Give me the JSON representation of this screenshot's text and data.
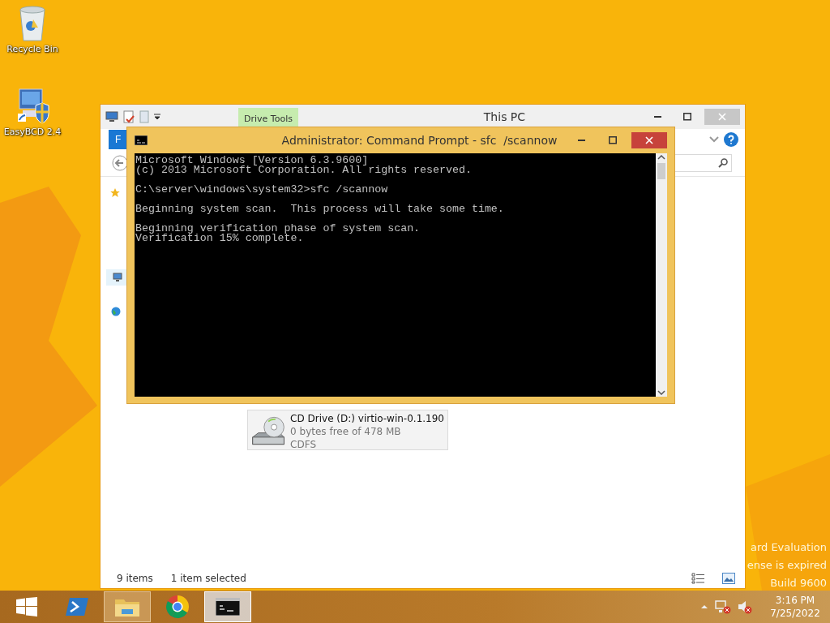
{
  "desktop_icons": [
    {
      "label": "Recycle Bin",
      "kind": "recycle-bin"
    },
    {
      "label": "EasyBCD 2.4",
      "kind": "app"
    }
  ],
  "explorer": {
    "title": "This PC",
    "context_tab": "Drive Tools",
    "ribbon_tab": "F",
    "drive": {
      "name": "CD Drive (D:) virtio-win-0.1.190",
      "free": "0 bytes free of 478 MB",
      "filesystem": "CDFS",
      "selected": true
    },
    "status": {
      "items": "9 items",
      "selection": "1 item selected"
    }
  },
  "console": {
    "title": "Administrator: Command Prompt - sfc  /scannow",
    "blocks": [
      [
        "Microsoft Windows [Version 6.3.9600]",
        "(c) 2013 Microsoft Corporation. All rights reserved."
      ],
      [
        "C:\\server\\windows\\system32>sfc /scannow"
      ],
      [
        "Beginning system scan.  This process will take some time."
      ],
      [
        "Beginning verification phase of system scan.",
        "Verification 15% complete."
      ]
    ]
  },
  "desktop_notice": [
    "ard Evaluation",
    "ense is expired",
    "Build 9600"
  ],
  "taskbar": {
    "apps": [
      {
        "kind": "start",
        "running": false,
        "selected": false
      },
      {
        "kind": "powershell",
        "running": false,
        "selected": false
      },
      {
        "kind": "explorer",
        "running": true,
        "selected": false
      },
      {
        "kind": "chrome",
        "running": false,
        "selected": false
      },
      {
        "kind": "console",
        "running": true,
        "selected": true
      }
    ],
    "clock": {
      "time": "3:16 PM",
      "date": "7/25/2022"
    }
  }
}
